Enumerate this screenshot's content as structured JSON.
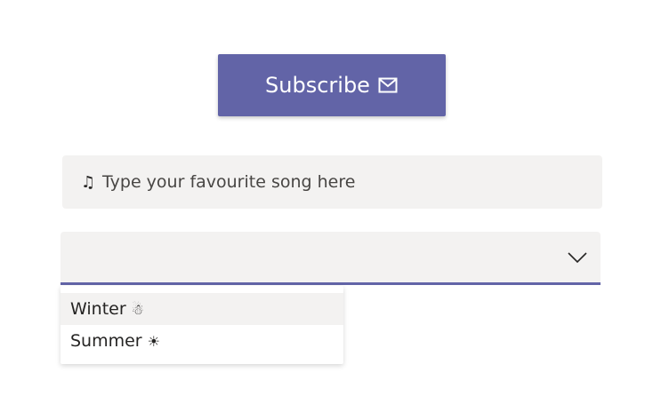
{
  "subscribe": {
    "label": "Subscribe",
    "icon": "envelope-icon",
    "color": "#6264a7"
  },
  "song_input": {
    "icon": "music-note-icon",
    "icon_glyph": "♫",
    "placeholder": "Type your favourite song here",
    "value": ""
  },
  "season_dropdown": {
    "selected_value": "",
    "icon": "chevron-down-icon",
    "accent_color": "#6264a7",
    "options": [
      {
        "label": "Winter",
        "emoji": "☃"
      },
      {
        "label": "Summer",
        "emoji": "☀"
      }
    ],
    "highlighted_index": 0
  }
}
